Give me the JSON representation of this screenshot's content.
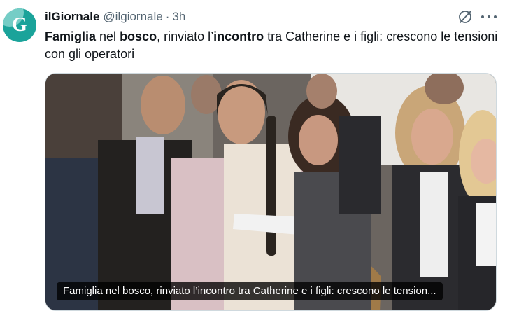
{
  "account": {
    "avatar_letter": "G",
    "name": "ilGiornale",
    "handle": "@ilgiornale",
    "separator": "·",
    "time": "3h"
  },
  "icons": {
    "grok": "grok-icon",
    "more": "more-icon"
  },
  "tweet": {
    "t1": "Famiglia",
    "t2": " nel ",
    "t3": "bosco",
    "t4": ", rinviato l’",
    "t5": "incontro",
    "t6": " tra Catherine e i figli: crescono le tensioni con gli operatori"
  },
  "media": {
    "caption": "Famiglia nel bosco, rinviato l’incontro tra Catherine e i figli: crescono le tension..."
  },
  "colors": {
    "avatar": "#1aa39a",
    "secondary_text": "#536471",
    "border": "#cfd9de"
  }
}
